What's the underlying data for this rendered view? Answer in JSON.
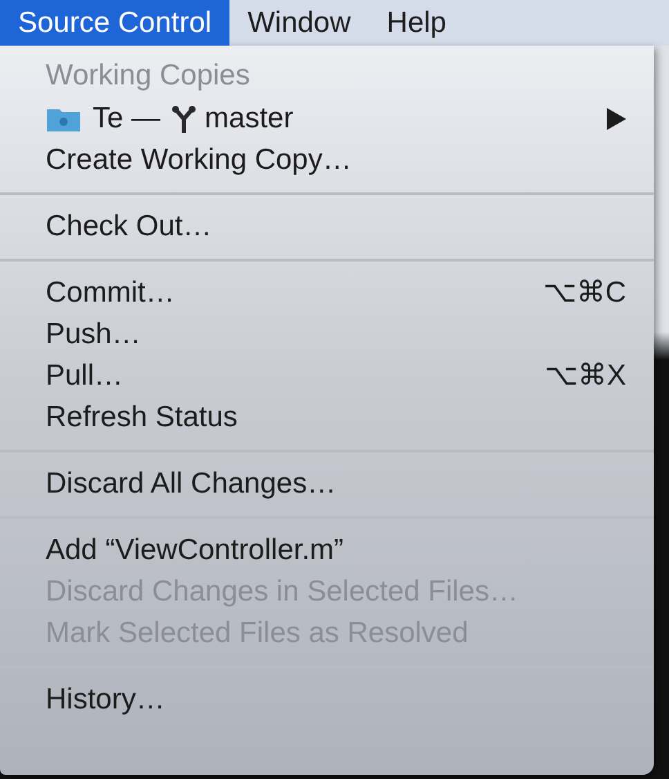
{
  "menubar": [
    {
      "label": "Source Control",
      "selected": true
    },
    {
      "label": "Window",
      "selected": false
    },
    {
      "label": "Help",
      "selected": false
    }
  ],
  "menu": {
    "items": [
      {
        "kind": "header",
        "label": "Working Copies"
      },
      {
        "kind": "repo",
        "label": "Te —",
        "branch": "master",
        "submenu": true,
        "disabled": false
      },
      {
        "kind": "item",
        "label": "Create Working Copy…",
        "disabled": false
      },
      {
        "kind": "separator"
      },
      {
        "kind": "item",
        "label": "Check Out…",
        "disabled": false
      },
      {
        "kind": "separator"
      },
      {
        "kind": "item",
        "label": "Commit…",
        "shortcut": "⌥⌘C",
        "disabled": false
      },
      {
        "kind": "item",
        "label": "Push…",
        "disabled": false
      },
      {
        "kind": "item",
        "label": "Pull…",
        "shortcut": "⌥⌘X",
        "disabled": false
      },
      {
        "kind": "item",
        "label": "Refresh Status",
        "disabled": false
      },
      {
        "kind": "separator"
      },
      {
        "kind": "item",
        "label": "Discard All Changes…",
        "disabled": false
      },
      {
        "kind": "separator"
      },
      {
        "kind": "item",
        "label": "Add “ViewController.m”",
        "disabled": false
      },
      {
        "kind": "item",
        "label": "Discard Changes in Selected Files…",
        "disabled": true
      },
      {
        "kind": "item",
        "label": "Mark Selected Files as Resolved",
        "disabled": true
      },
      {
        "kind": "separator"
      },
      {
        "kind": "item",
        "label": "History…",
        "disabled": false
      }
    ]
  }
}
